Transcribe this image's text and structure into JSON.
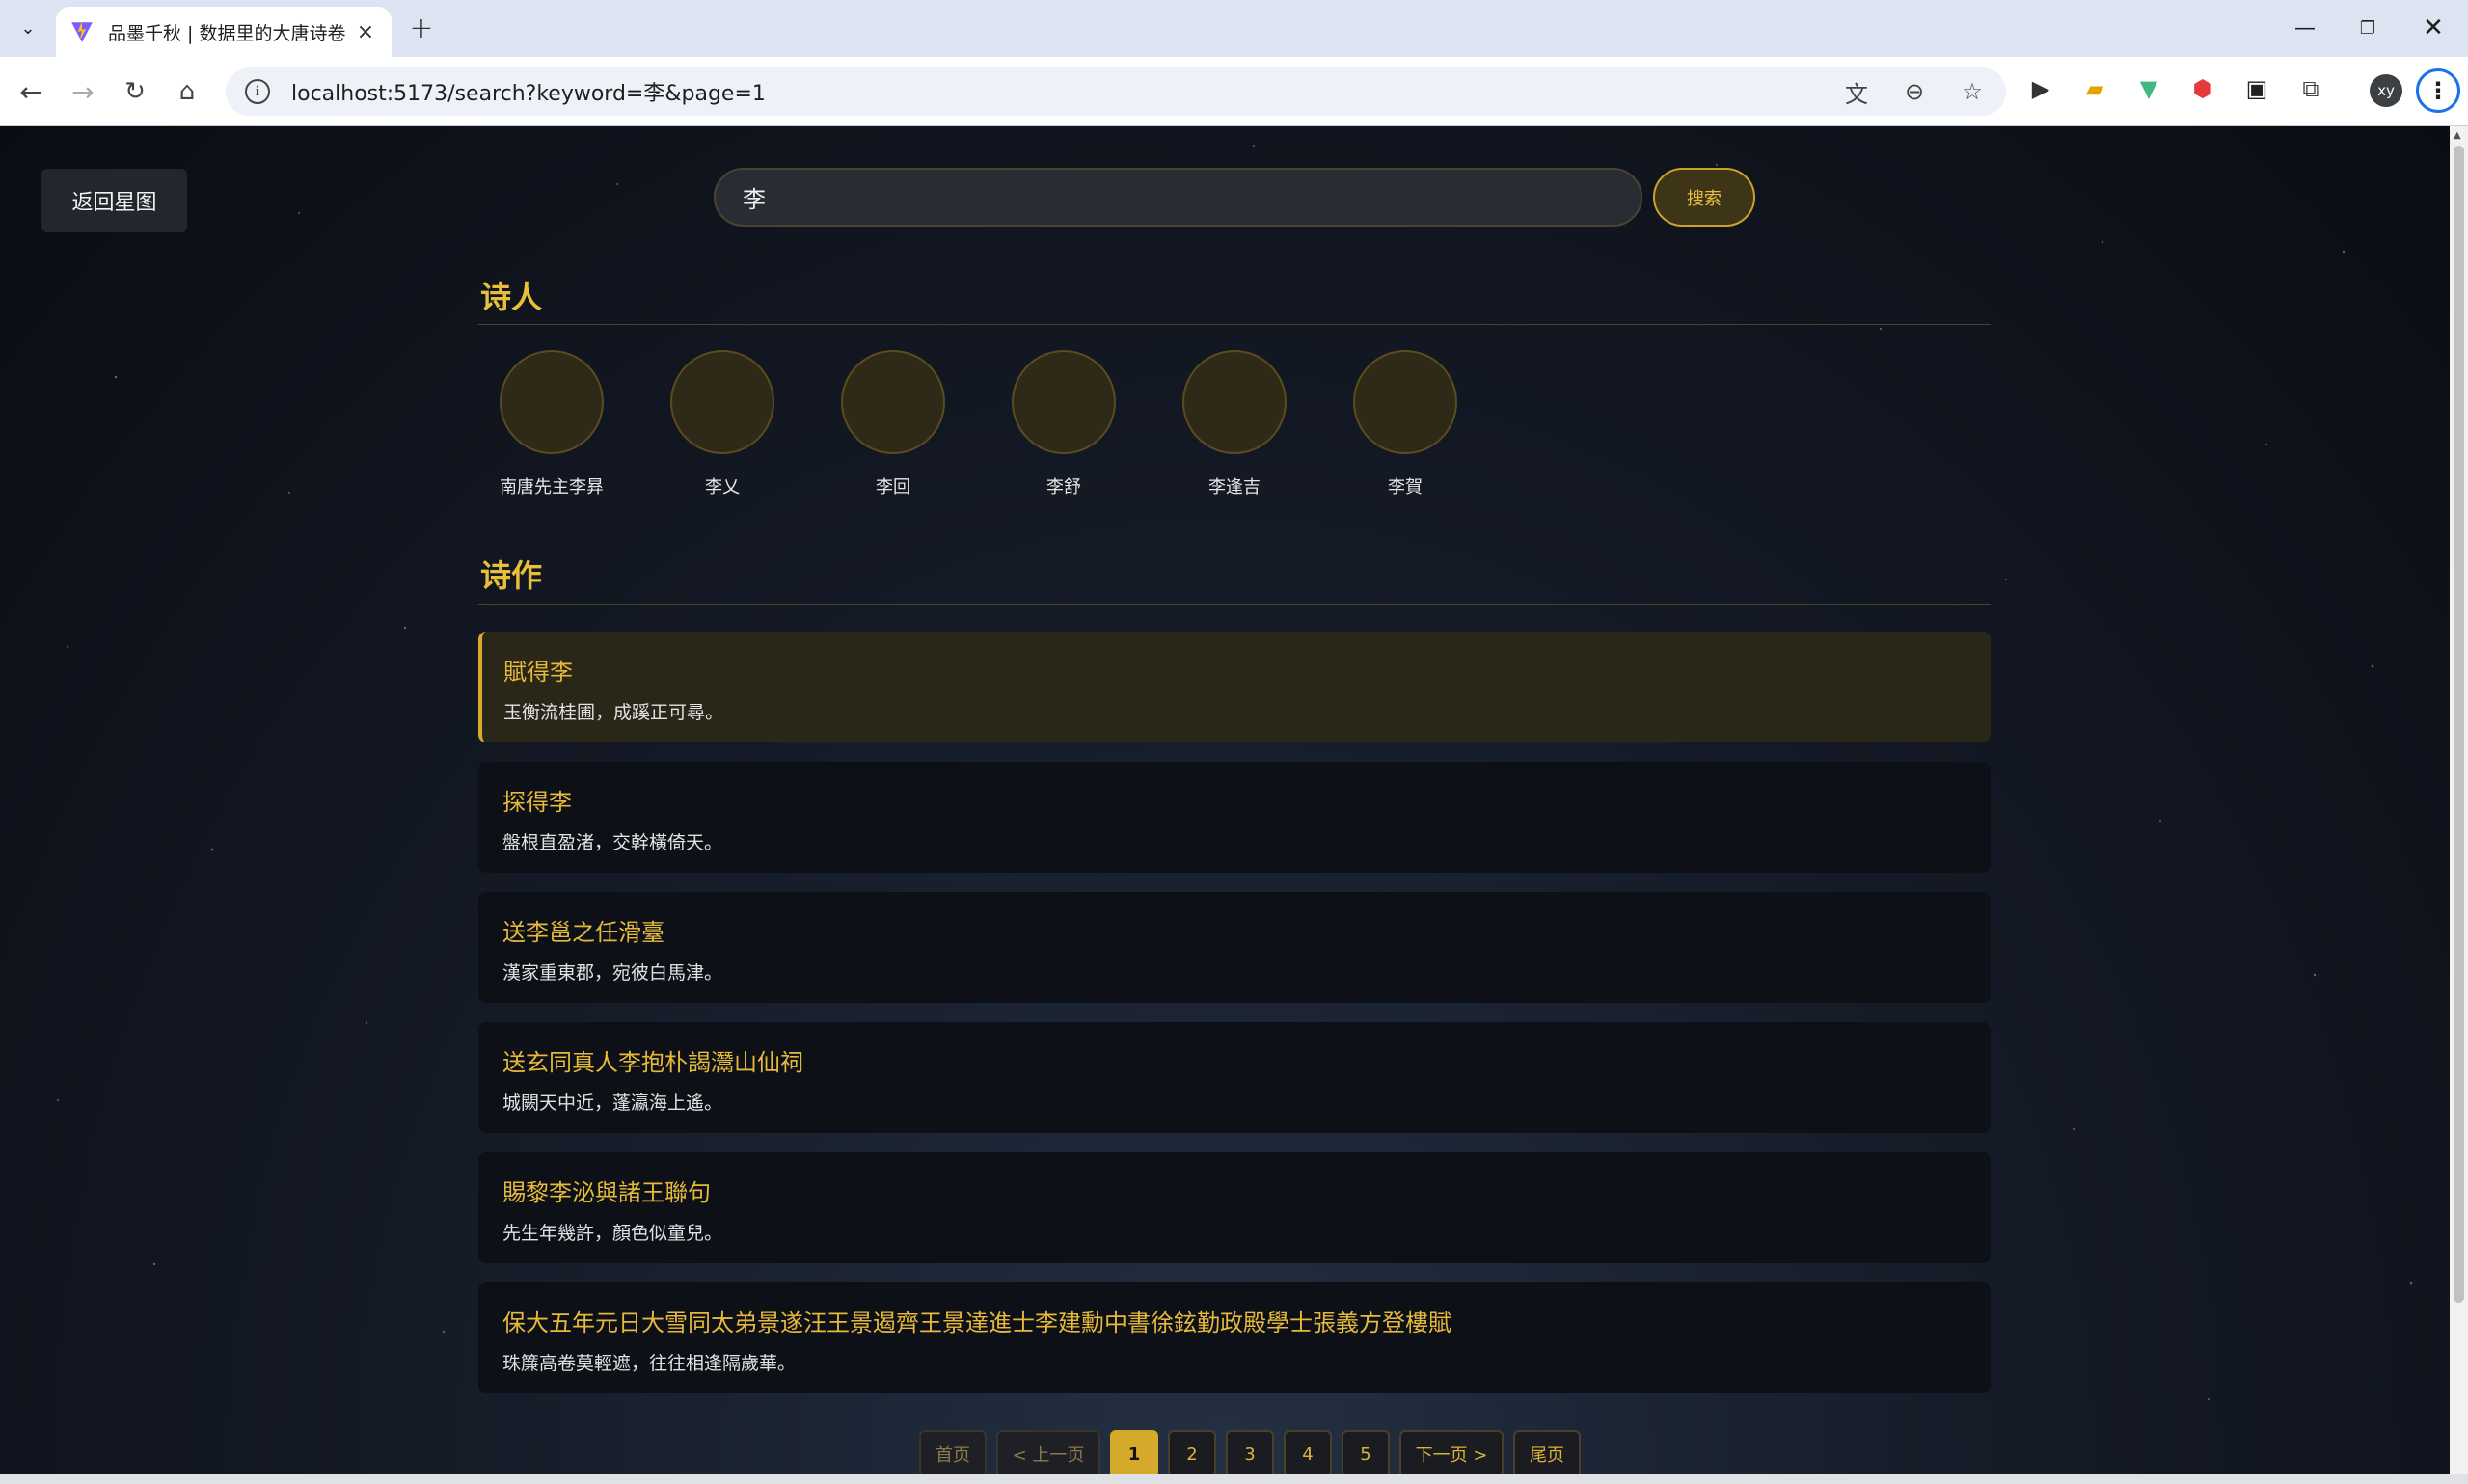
{
  "browser": {
    "tab_title": "品墨千秋 | 数据里的大唐诗卷",
    "url": "localhost:5173/search?keyword=李&page=1",
    "profile_initials": "xy"
  },
  "page": {
    "back_label": "返回星图",
    "search": {
      "value": "李",
      "button_label": "搜索"
    },
    "poets_title": "诗人",
    "poets": [
      {
        "name": "南唐先主李昪"
      },
      {
        "name": "李乂"
      },
      {
        "name": "李回"
      },
      {
        "name": "李舒"
      },
      {
        "name": "李逢吉"
      },
      {
        "name": "李賀"
      }
    ],
    "poems_title": "诗作",
    "poems": [
      {
        "title": "賦得李",
        "line": "玉衡流桂圃，成蹊正可尋。"
      },
      {
        "title": "探得李",
        "line": "盤根直盈渚，交幹橫倚天。"
      },
      {
        "title": "送李邕之任滑臺",
        "line": "漢家重東郡，宛彼白馬津。"
      },
      {
        "title": "送玄同真人李抱朴謁灊山仙祠",
        "line": "城闕天中近，蓬瀛海上遙。"
      },
      {
        "title": "賜黎李泌與諸王聯句",
        "line": "先生年幾許，顏色似童兒。"
      },
      {
        "title": "保大五年元日大雪同太弟景遂汪王景遏齊王景達進士李建勳中書徐鉉勤政殿學士張義方登樓賦",
        "line": "珠簾高卷莫輕遮，往往相逢隔歲華。"
      }
    ],
    "pagination": {
      "first": "首页",
      "prev": "< 上一页",
      "pages": [
        "1",
        "2",
        "3",
        "4",
        "5"
      ],
      "current": "1",
      "next": "下一页 >",
      "last": "尾页"
    }
  },
  "colors": {
    "accent": "#e8bf38",
    "background": "#0a0d14",
    "card": "#0d1017",
    "card_active": "#2a2719"
  }
}
